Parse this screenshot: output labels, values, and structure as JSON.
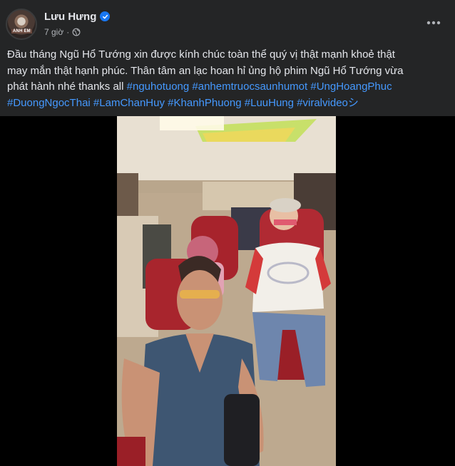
{
  "post": {
    "author": "Lưu Hưng",
    "time": "7 giờ",
    "avatar_text": "ANH EM",
    "text_lines": [
      "Đầu tháng Ngũ Hổ Tướng xin được kính chúc toàn thể quý vị thật mạnh khoẻ thật",
      "may mắn thật hạnh phúc. Thân tâm an lạc hoan hỉ ủng hộ phim Ngũ Hổ Tướng vừa",
      "phát hành nhé thanks all"
    ],
    "hashtags": [
      "#nguhotuong",
      "#anhemtruocsaunhumot",
      "#UngHoangPhuc",
      "#DuongNgocThai",
      "#LamChanHuy",
      "#KhanhPhuong",
      "#LuuHung",
      "#viralvideo"
    ],
    "trailing_symbol": "シ"
  },
  "icons": {
    "verified": "verified-badge-icon",
    "audience": "globe-icon",
    "more": "more-options-icon"
  },
  "colors": {
    "background": "#242526",
    "text": "#e4e6eb",
    "muted": "#b0b3b8",
    "hashtag": "#4599ff",
    "verified": "#1877f2"
  }
}
